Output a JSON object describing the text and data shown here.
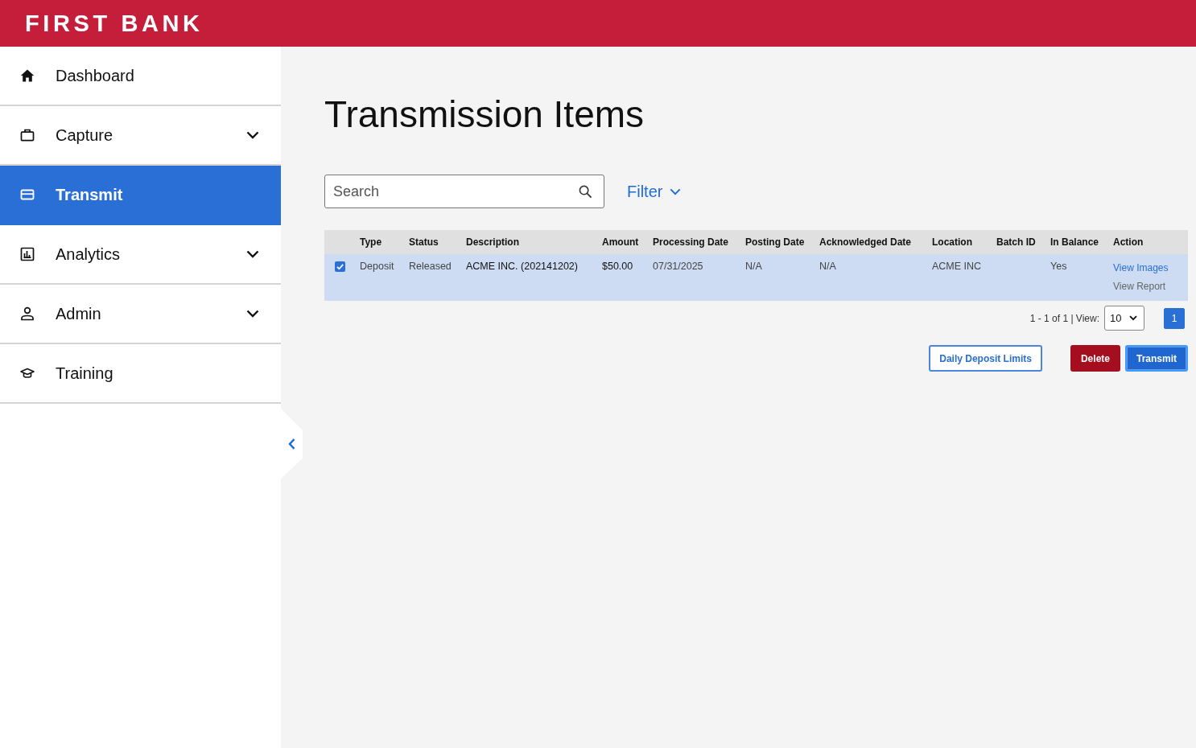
{
  "header": {
    "logo": "FIRST BANK"
  },
  "sidebar": {
    "items": [
      {
        "label": "Dashboard",
        "has_submenu": false,
        "selected": false
      },
      {
        "label": "Capture",
        "has_submenu": true,
        "selected": false
      },
      {
        "label": "Transmit",
        "has_submenu": false,
        "selected": true
      },
      {
        "label": "Analytics",
        "has_submenu": true,
        "selected": false
      },
      {
        "label": "Admin",
        "has_submenu": true,
        "selected": false
      },
      {
        "label": "Training",
        "has_submenu": false,
        "selected": false
      }
    ]
  },
  "page": {
    "title": "Transmission Items"
  },
  "search": {
    "placeholder": "Search"
  },
  "filter": {
    "label": "Filter"
  },
  "table": {
    "columns": [
      "Type",
      "Status",
      "Description",
      "Amount",
      "Processing Date",
      "Posting Date",
      "Acknowledged Date",
      "Location",
      "Batch ID",
      "In Balance",
      "Action"
    ],
    "rows": [
      {
        "selected": true,
        "checked": true,
        "type": "Deposit",
        "status": "Released",
        "description": "ACME INC. (202141202)",
        "amount": "$50.00",
        "processing_date": "07/31/2025",
        "posting_date": "N/A",
        "acknowledged_date": "N/A",
        "location": "ACME INC",
        "in_balance": "Yes",
        "actions": [
          {
            "label": "View Images",
            "disabled": false
          },
          {
            "label": "View Report",
            "disabled": true
          }
        ]
      }
    ]
  },
  "pagination": {
    "summary": "1 - 1 of 1 | View:",
    "page_size": "10",
    "pages": [
      {
        "label": "1",
        "selected": true
      }
    ]
  },
  "buttons": [
    {
      "label": "Daily Deposit Limits",
      "kind": "outline",
      "focused": false
    },
    {
      "label": "Delete",
      "kind": "danger",
      "focused": false
    },
    {
      "label": "Transmit",
      "kind": "primary",
      "focused": true
    }
  ]
}
